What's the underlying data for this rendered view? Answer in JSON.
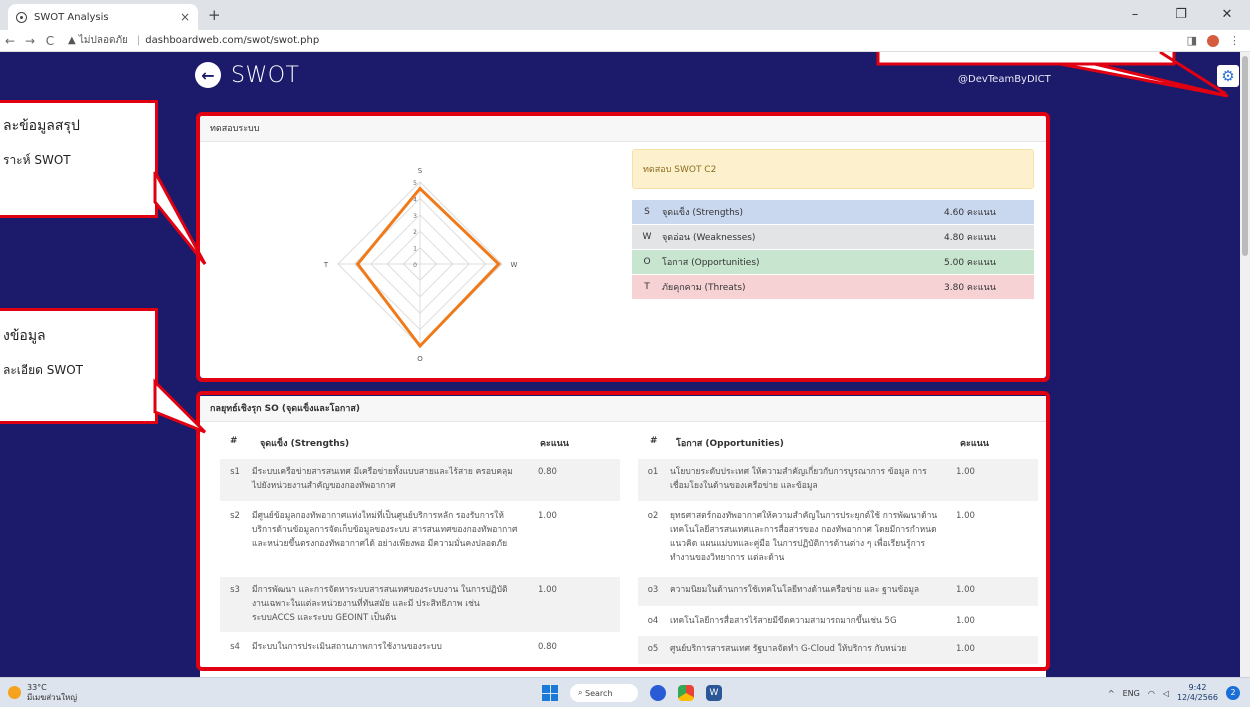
{
  "browser": {
    "tab_title": "SWOT Analysis",
    "tab_close": "×",
    "new_tab": "+",
    "back": "←",
    "forward": "→",
    "reload": "C",
    "security_warning": "▲ ไม่ปลอดภัย",
    "url": "dashboardweb.com/swot/swot.php",
    "win_min": "–",
    "win_max": "❐",
    "win_close": "✕"
  },
  "header": {
    "title": "SWOT",
    "credit": "@DevTeamByDICT",
    "back_icon": "←",
    "settings_icon": "⚙"
  },
  "panel1": {
    "heading": "ทดสอบระบบ",
    "summary_title": "ทดสอบ SWOT C2",
    "rows": [
      {
        "key": "S",
        "label": "จุดแข็ง (Strengths)",
        "value": "4.60 คะแนน",
        "color": "#c9d8ef"
      },
      {
        "key": "W",
        "label": "จุดอ่อน (Weaknesses)",
        "value": "4.80 คะแนน",
        "color": "#e3e4e6"
      },
      {
        "key": "O",
        "label": "โอกาส (Opportunities)",
        "value": "5.00 คะแนน",
        "color": "#c8e5d0"
      },
      {
        "key": "T",
        "label": "ภัยคุกคาม (Threats)",
        "value": "3.80 คะแนน",
        "color": "#f6d2d5"
      }
    ]
  },
  "chart_data": {
    "type": "radar",
    "axes": [
      "S",
      "W",
      "O",
      "T"
    ],
    "values": [
      4.6,
      4.8,
      5.0,
      3.8
    ],
    "rmax": 5,
    "ticks": [
      "0",
      "1",
      "2",
      "3",
      "4",
      "5"
    ],
    "color": "#f07a1a"
  },
  "panel2": {
    "heading": "กลยุทธ์เชิงรุก SO (จุดแข็งและโอกาส)",
    "left_headers": {
      "num": "#",
      "label": "จุดแข็ง (Strengths)",
      "score": "คะแนน"
    },
    "right_headers": {
      "num": "#",
      "label": "โอกาส (Opportunities)",
      "score": "คะแนน"
    },
    "strengths": [
      {
        "id": "s1",
        "text": "มีระบบเครือข่ายสารสนเทศ มีเครือข่ายทั้งแบบสายและไร้สาย ครอบคลุมไปยังหน่วยงานสำคัญของกองทัพอากาศ",
        "score": "0.80"
      },
      {
        "id": "s2",
        "text": "มีศูนย์ข้อมูลกองทัพอากาศแห่งใหม่ที่เป็นศูนย์บริการหลัก รองรับการให้บริการด้านข้อมูลการจัดเก็บข้อมูลของระบบ สารสนเทศของกองทัพอากาศ และหน่วยขึ้นตรงกองทัพอากาศได้ อย่างเพียงพอ มีความมั่นคงปลอดภัย",
        "score": "1.00"
      },
      {
        "id": "s3",
        "text": "มีการพัฒนา และการจัดหาระบบสารสนเทศของระบบงาน ในการปฏิบัติงานเฉพาะในแต่ละหน่วยงานที่ทันสมัย และมี ประสิทธิภาพ เช่น ระบบACCS และระบบ GEOINT เป็นต้น",
        "score": "1.00"
      },
      {
        "id": "s4",
        "text": "มีระบบในการประเมินสถานภาพการใช้งานของระบบ",
        "score": "0.80"
      }
    ],
    "opportunities": [
      {
        "id": "o1",
        "text": "นโยบายระดับประเทศ ให้ความสำคัญเกี่ยวกับการบูรณาการ ข้อมูล การเชื่อมโยงในด้านของเครือข่าย และข้อมูล",
        "score": "1.00"
      },
      {
        "id": "o2",
        "text": "ยุทธศาสตร์กองทัพอากาศให้ความสำคัญในการประยุกต์ใช้ การพัฒนาด้านเทคโนโลยีสารสนเทศและการสื่อสารของ กองทัพอากาศ โดยมีการกำหนดแนวคิด แผนแม่บทและคู่มือ ในการปฏิบัติการด้านต่าง ๆ เพื่อเรียนรู้การทำงานของวิทยาการ แต่ละด้าน",
        "score": "1.00"
      },
      {
        "id": "o3",
        "text": "ความนิยมในด้านการใช้เทคโนโลยีทางด้านเครือข่าย และ ฐานข้อมูล",
        "score": "1.00"
      },
      {
        "id": "o4",
        "text": "เทคโนโลยีการสื่อสารไร้สายมีขีดความสามารถมากขึ้นเช่น 5G",
        "score": "1.00"
      },
      {
        "id": "o5",
        "text": "ศูนย์บริการสารสนเทศ รัฐบาลจัดทำ G-Cloud ให้บริการ กับหน่วย",
        "score": "1.00"
      }
    ]
  },
  "callouts": {
    "c1_line1": "ละข้อมูลสรุป",
    "c1_line2": "ราะห์ SWOT",
    "c2_line1": "งข้อมูล",
    "c2_line2": "ละเอียด SWOT"
  },
  "taskbar": {
    "temp": "33°C",
    "weather": "มีเมฆส่วนใหญ่",
    "search": "Search",
    "lang": "ENG",
    "time": "9:42",
    "date": "12/4/2566",
    "notif_count": "2"
  }
}
